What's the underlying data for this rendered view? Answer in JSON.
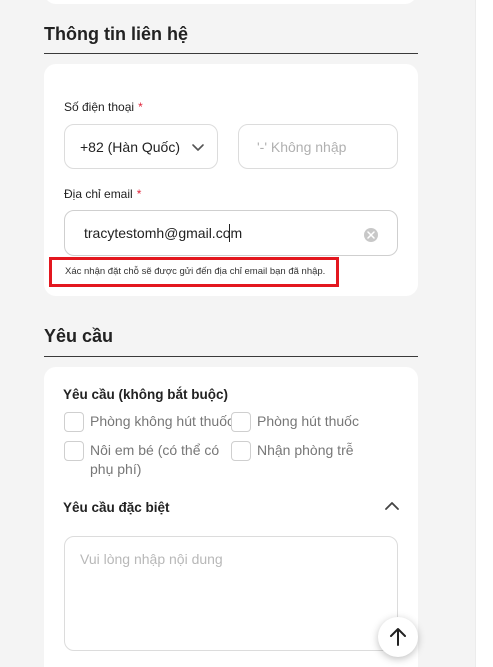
{
  "contact_section": {
    "title": "Thông tin liên hệ",
    "phone_label": "Số điện thoại",
    "required_mark": "*",
    "country_code_value": "+82 (Hàn Quốc)",
    "phone_placeholder": "'-' Không nhập",
    "email_label": "Địa chỉ email",
    "email_value": "tracytestomh@gmail.com",
    "email_hint": "Xác nhận đặt chỗ sẽ được gửi đến địa chỉ email bạn đã nhập."
  },
  "request_section": {
    "title": "Yêu cầu",
    "optional_heading": "Yêu cầu (không bắt buộc)",
    "options": [
      "Phòng không hút thuốc",
      "Phòng hút thuốc",
      "Nôi em bé (có thể có phụ phí)",
      "Nhận phòng trễ"
    ],
    "special_heading": "Yêu cầu đặc biệt",
    "special_placeholder": "Vui lòng nhập nội dung"
  },
  "colors": {
    "accent_error": "#e3171f",
    "required_star": "#e0243a"
  }
}
